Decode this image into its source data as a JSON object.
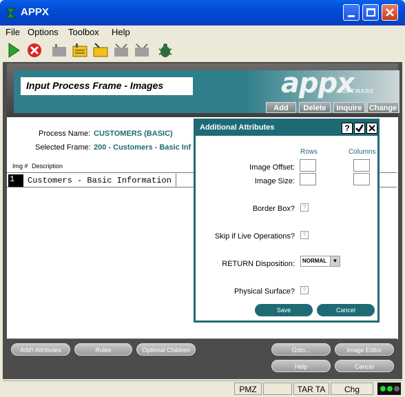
{
  "window": {
    "title": "APPX"
  },
  "menu": [
    "File",
    "Options",
    "Toolbox",
    "Help"
  ],
  "toolbar": {
    "icons": [
      "play-icon",
      "stop-icon",
      "folder-icon",
      "notepad-icon",
      "folder-edit-icon",
      "folder2-icon",
      "folder3-icon",
      "bug-icon"
    ]
  },
  "header": {
    "title": "Input Process Frame - Images",
    "logo_text": "appx",
    "logo_sub": "SOFTWARE",
    "buttons": [
      "Add",
      "Delete",
      "Inquire",
      "Change"
    ]
  },
  "form": {
    "process_name_label": "Process Name:",
    "process_name_value": "CUSTOMERS (BASIC)",
    "selected_frame_label": "Selected Frame:",
    "selected_frame_value": "200 - Customers - Basic Inf",
    "col_img": "Img #",
    "col_desc": "Description",
    "rows": [
      {
        "img": "1",
        "desc": "Customers - Basic Information"
      }
    ]
  },
  "footer": {
    "buttons": [
      "Add'l Attributes",
      "Rules",
      "Optional Children",
      "Goto...",
      "Image Editor",
      "Help",
      "Cancel"
    ]
  },
  "dialog": {
    "title": "Additional Attributes",
    "col_rows": "Rows",
    "col_columns": "Columns",
    "image_offset_label": "Image Offset:",
    "image_size_label": "Image Size:",
    "border_box_label": "Border Box?",
    "skip_live_label": "Skip if Live Operations?",
    "return_label": "RETURN Disposition:",
    "return_value": "NORMAL",
    "physical_label": "Physical Surface?",
    "check_glyph": "?",
    "save": "Save",
    "cancel": "Cancel"
  },
  "statusbar": [
    "PMZ",
    "",
    "TAR TA",
    "Chg"
  ]
}
